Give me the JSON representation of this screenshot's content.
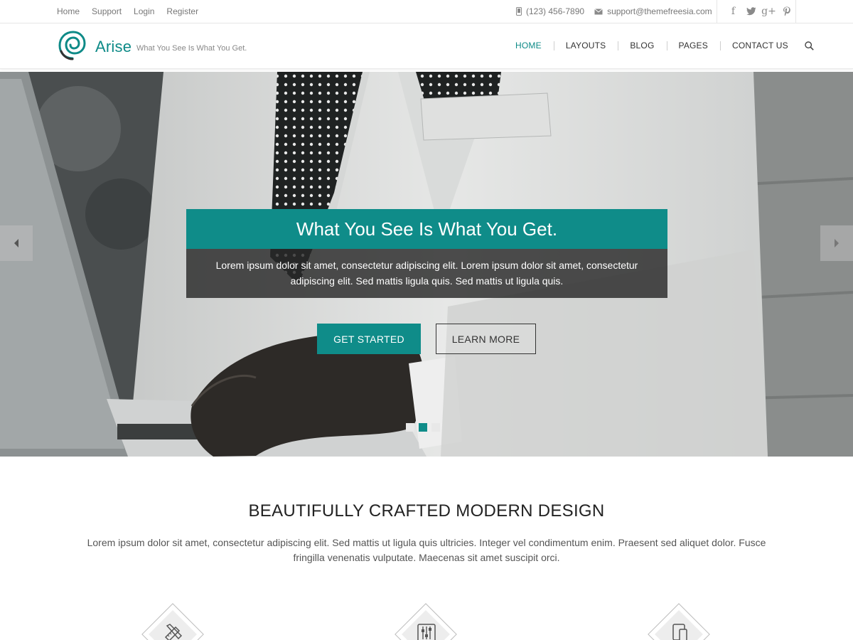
{
  "topbar": {
    "links": [
      "Home",
      "Support",
      "Login",
      "Register"
    ],
    "phone": "(123) 456-7890",
    "email": "support@themefreesia.com",
    "socials": [
      "facebook-icon",
      "twitter-icon",
      "google-plus-icon",
      "pinterest-icon"
    ]
  },
  "header": {
    "site_title": "Arise",
    "tagline": "What You See Is What You Get.",
    "nav": [
      "HOME",
      "LAYOUTS",
      "BLOG",
      "PAGES",
      "CONTACT US"
    ],
    "active_nav": "HOME"
  },
  "hero": {
    "title": "What You See Is What You Get.",
    "text": "Lorem ipsum dolor sit amet, consectetur adipiscing elit. Lorem ipsum dolor sit amet, consectetur adipiscing elit. Sed mattis ligula quis. Sed mattis ut ligula quis.",
    "primary_button": "GET STARTED",
    "secondary_button": "LEARN MORE",
    "slides_total": 3,
    "active_slide": 2
  },
  "intro": {
    "title": "BEAUTIFULLY CRAFTED MODERN DESIGN",
    "text": "Lorem ipsum dolor sit amet, consectetur adipiscing elit. Sed mattis ut ligula quis ultricies. Integer vel condimentum enim. Praesent sed aliquet dolor. Fusce fringilla venenatis vulputate. Maecenas sit amet suscipit orci."
  },
  "features": [
    "pencil-ruler-icon",
    "sliders-icon",
    "devices-icon"
  ],
  "colors": {
    "accent": "#0f8c89",
    "text_dark": "#222222",
    "text_muted": "#777777"
  }
}
